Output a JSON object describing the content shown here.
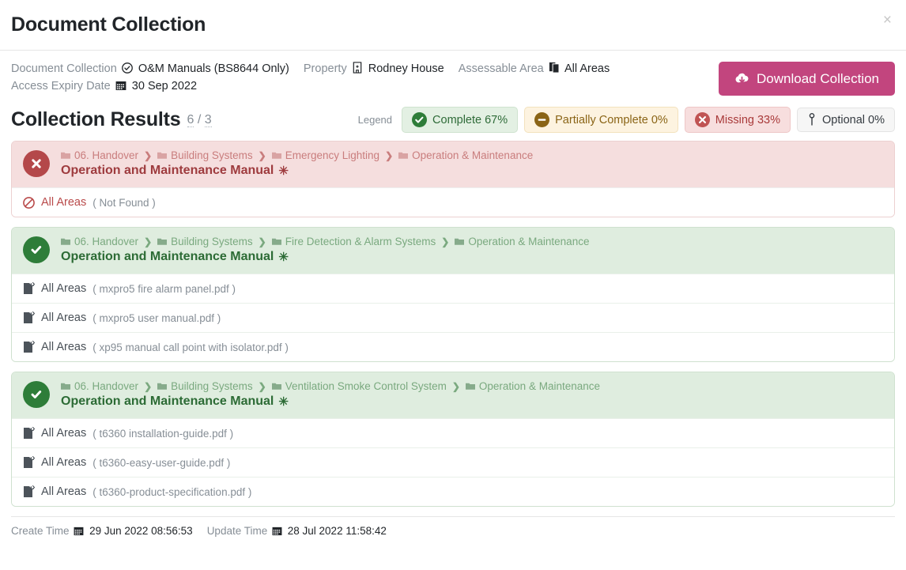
{
  "window": {
    "title": "Document Collection",
    "close_label": "×"
  },
  "meta": {
    "line1": [
      {
        "label": "Document Collection",
        "icon": "check-circle-icon",
        "value": "O&M Manuals (BS8644 Only)"
      },
      {
        "label": "Property",
        "icon": "building-icon",
        "value": "Rodney House"
      },
      {
        "label": "Assessable Area",
        "icon": "layers-icon",
        "value": "All Areas"
      }
    ],
    "line2": [
      {
        "label": "Access Expiry Date",
        "icon": "calendar-icon",
        "value": "30 Sep 2022"
      }
    ]
  },
  "download_button": {
    "label": "Download Collection",
    "icon": "cloud-download-icon",
    "color": "#c2457e"
  },
  "results": {
    "title": "Collection Results",
    "count_found": "6",
    "count_separator": "/",
    "count_total": "3"
  },
  "legend": {
    "label": "Legend",
    "items": [
      {
        "key": "complete",
        "label": "Complete 67%",
        "icon": "check-circle-icon",
        "bg": "#e3f0e3",
        "fg": "#2e6b38"
      },
      {
        "key": "partial",
        "label": "Partially Complete 0%",
        "icon": "minus-circle-icon",
        "bg": "#fdf3e0",
        "fg": "#8a6416"
      },
      {
        "key": "missing",
        "label": "Missing 33%",
        "icon": "times-circle-icon",
        "bg": "#f7dede",
        "fg": "#a93a3a"
      },
      {
        "key": "optional",
        "label": "Optional 0%",
        "icon": "pin-icon",
        "bg": "#f6f6f6",
        "fg": "#343a40"
      }
    ]
  },
  "cards": [
    {
      "status": "missing",
      "status_icon": "times-circle-icon",
      "breadcrumbs": [
        "06. Handover",
        "Building Systems",
        "Emergency Lighting",
        "Operation & Maintenance"
      ],
      "doc_title": "Operation and Maintenance Manual",
      "required_marker": "✳",
      "rows": [
        {
          "icon": "no-entry-icon",
          "area": "All Areas",
          "file": "( Not Found )"
        }
      ]
    },
    {
      "status": "complete",
      "status_icon": "check-circle-icon",
      "breadcrumbs": [
        "06. Handover",
        "Building Systems",
        "Fire Detection & Alarm Systems",
        "Operation & Maintenance"
      ],
      "doc_title": "Operation and Maintenance Manual",
      "required_marker": "✳",
      "rows": [
        {
          "icon": "file-export-icon",
          "area": "All Areas",
          "file": "( mxpro5 fire alarm panel.pdf )"
        },
        {
          "icon": "file-export-icon",
          "area": "All Areas",
          "file": "( mxpro5 user manual.pdf )"
        },
        {
          "icon": "file-export-icon",
          "area": "All Areas",
          "file": "( xp95 manual call point with isolator.pdf )"
        }
      ]
    },
    {
      "status": "complete",
      "status_icon": "check-circle-icon",
      "breadcrumbs": [
        "06. Handover",
        "Building Systems",
        "Ventilation Smoke Control System",
        "Operation & Maintenance"
      ],
      "doc_title": "Operation and Maintenance Manual",
      "required_marker": "✳",
      "rows": [
        {
          "icon": "file-export-icon",
          "area": "All Areas",
          "file": "( t6360 installation-guide.pdf )"
        },
        {
          "icon": "file-export-icon",
          "area": "All Areas",
          "file": "( t6360-easy-user-guide.pdf )"
        },
        {
          "icon": "file-export-icon",
          "area": "All Areas",
          "file": "( t6360-product-specification.pdf )"
        }
      ]
    }
  ],
  "footer": {
    "create_label": "Create Time",
    "create_value": "29 Jun 2022 08:56:53",
    "update_label": "Update Time",
    "update_value": "28 Jul 2022 11:58:42",
    "calendar_icon": "calendar-icon"
  }
}
